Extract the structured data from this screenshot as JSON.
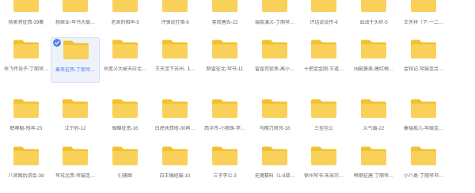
{
  "colors": {
    "folder_body": "#f9d15a",
    "folder_tab": "#f2c12e",
    "selection_bg": "#eef3fb",
    "selection_accent": "#4f81e8",
    "label_text": "#666666"
  },
  "icons": {
    "folder": "folder-icon",
    "selected_check": "check-circle-icon"
  },
  "rows": [
    {
      "items": [
        {
          "label": "杨家将征西-39集",
          "selected": false
        },
        {
          "label": "杨继业-琴书大鼓…",
          "selected": false
        },
        {
          "label": "老舍的相声-5",
          "selected": false
        },
        {
          "label": "评弹说打猎-6",
          "selected": false
        },
        {
          "label": "笑岗唐告-22",
          "selected": false
        },
        {
          "label": "瑞霞演义-丁丽琴…",
          "selected": false
        },
        {
          "label": "评话说说传-6",
          "selected": false
        },
        {
          "label": "血战千头岭-5",
          "selected": false
        },
        {
          "label": "王天祥（下·一二…",
          "selected": false
        }
      ]
    },
    {
      "items": [
        {
          "label": "岳飞传说子-丁丽琴…",
          "selected": false
        },
        {
          "label": "秦英征西-丁丽琴…",
          "selected": true
        },
        {
          "label": "岳宽义大破天应北…",
          "selected": false
        },
        {
          "label": "王天宝下苏州-【…",
          "selected": false
        },
        {
          "label": "醉雷征北-琴书-11",
          "selected": false
        },
        {
          "label": "雷霆司徒侠-高小…",
          "selected": false
        },
        {
          "label": "十把金金刚-王道…",
          "selected": false
        },
        {
          "label": "闯殿褒美-唐红梅…",
          "selected": false
        },
        {
          "label": "金钩记-琴鼓连合…",
          "selected": false
        }
      ]
    },
    {
      "items": [
        {
          "label": "鹤啄鲶-残琴-23",
          "selected": false
        },
        {
          "label": "江宁府-12",
          "selected": false
        },
        {
          "label": "蝴蝶征南-16",
          "selected": false
        },
        {
          "label": "白虎扶西塔-30再…",
          "selected": false
        },
        {
          "label": "西洋传-小丽珠-李…",
          "selected": false
        },
        {
          "label": "马棚刀揭邻-18",
          "selected": false
        },
        {
          "label": "三挂包公",
          "selected": false
        },
        {
          "label": "义气霸-22",
          "selected": false
        },
        {
          "label": "秦瑞孤儿-琴鼓连…",
          "selected": false
        }
      ]
    },
    {
      "items": [
        {
          "label": "八贤图后游会-38",
          "selected": false
        },
        {
          "label": "琴戎尤西-琴鼓连…",
          "selected": false
        },
        {
          "label": "们捕继",
          "selected": false
        },
        {
          "label": "白王稿经鼓-10",
          "selected": false
        },
        {
          "label": "三子李公-3",
          "selected": false
        },
        {
          "label": "无愧赛科（1-8部…",
          "selected": false
        },
        {
          "label": "徐州琴书-朱采宗…",
          "selected": false
        },
        {
          "label": "韩钢征唐-丁丽琴…",
          "selected": false
        },
        {
          "label": "小八类-丁丽琴书…",
          "selected": false
        }
      ]
    }
  ]
}
